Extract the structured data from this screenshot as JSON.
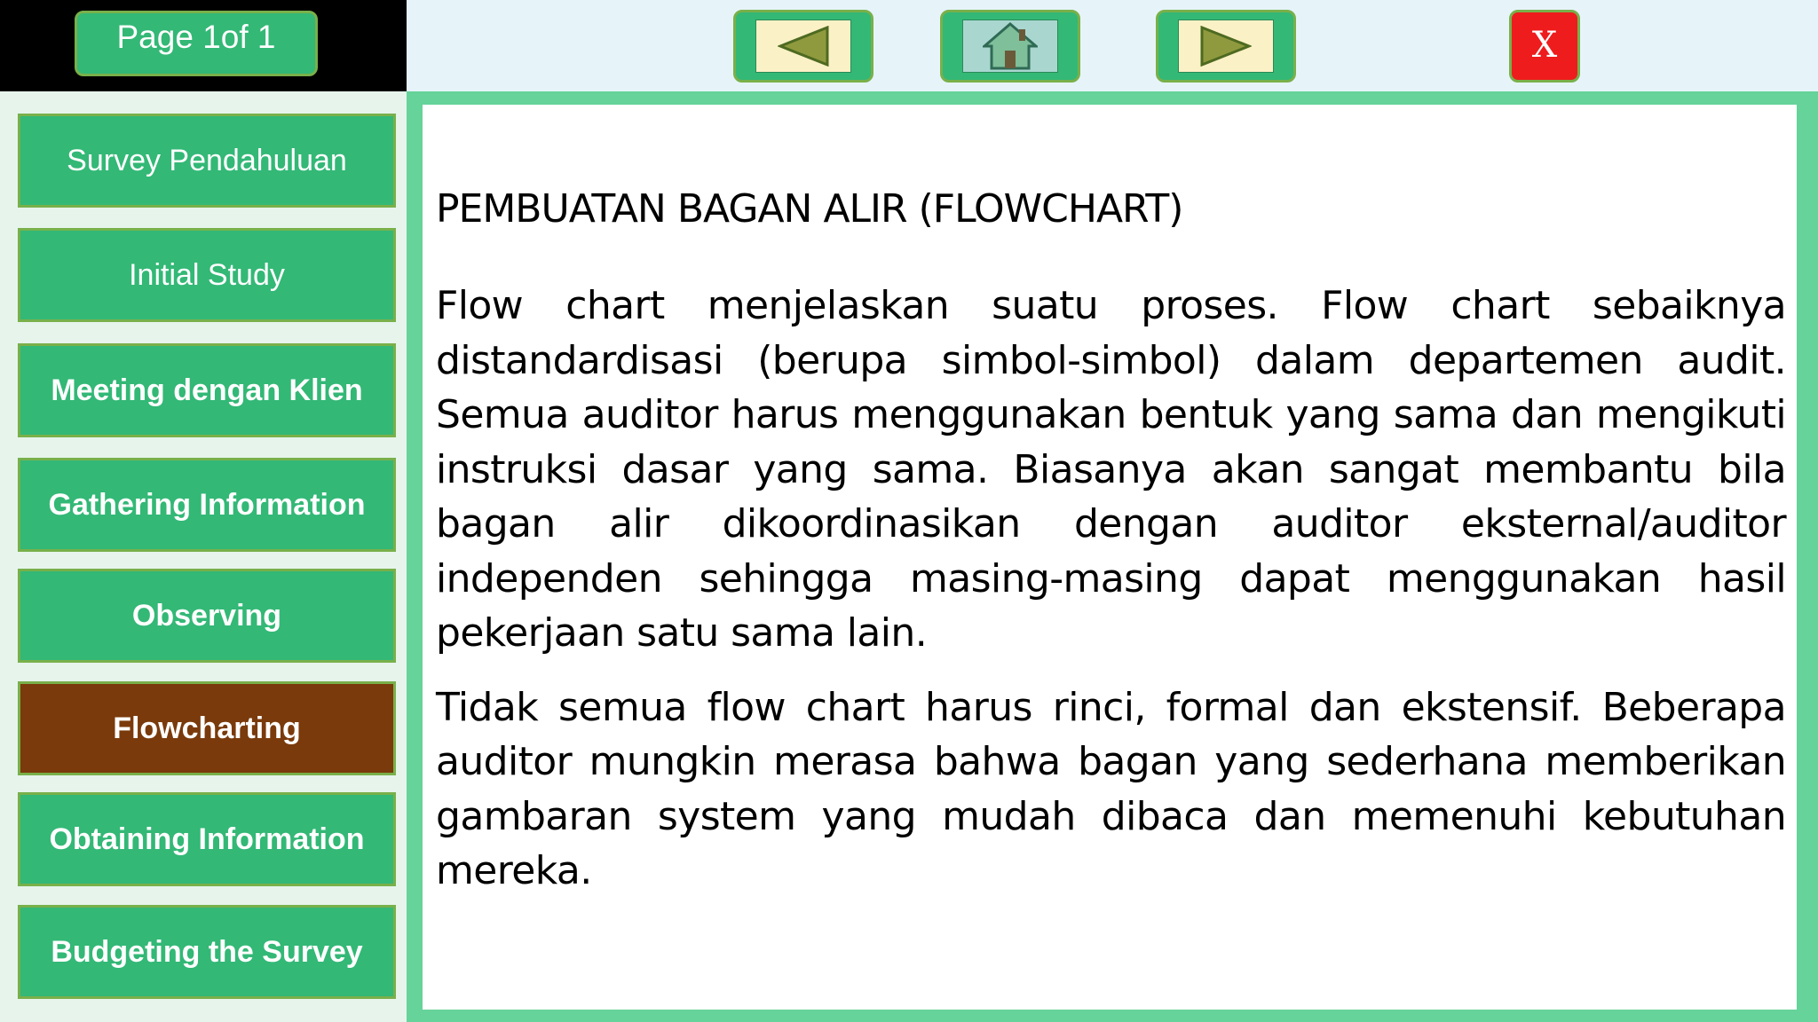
{
  "header": {
    "page_indicator": "Page 1of 1",
    "close_label": "X"
  },
  "icons": {
    "prev": "left-triangle-icon",
    "home": "home-icon",
    "next": "right-triangle-icon"
  },
  "colors": {
    "button_green": "#33b876",
    "button_border": "#79b04a",
    "active_brown": "#7a3a0b",
    "close_red": "#ee1c1c",
    "frame_green": "#66d39a"
  },
  "sidebar": {
    "items": [
      {
        "label": "Survey Pendahuluan"
      },
      {
        "label": "Initial Study"
      },
      {
        "label": "Meeting dengan Klien"
      },
      {
        "label": "Gathering Information"
      },
      {
        "label": "Observing"
      },
      {
        "label": "Flowcharting",
        "active": true
      },
      {
        "label": "Obtaining Information"
      },
      {
        "label": "Budgeting the Survey"
      }
    ]
  },
  "content": {
    "title": "PEMBUATAN BAGAN ALIR (FLOWCHART)",
    "paragraphs": [
      "Flow chart menjelaskan suatu proses. Flow chart sebaiknya distandardisasi (berupa  simbol-simbol) dalam departemen audit. Semua auditor harus menggunakan bentuk yang sama dan mengikuti instruksi dasar yang sama. Biasanya akan sangat membantu bila bagan alir dikoordinasikan dengan auditor eksternal/auditor independen sehingga masing-masing dapat menggunakan hasil pekerjaan satu sama lain.",
      "Tidak semua flow chart harus rinci, formal  dan ekstensif. Beberapa auditor mungkin merasa bahwa bagan yang sederhana memberikan gambaran system yang mudah dibaca dan memenuhi kebutuhan mereka."
    ]
  }
}
